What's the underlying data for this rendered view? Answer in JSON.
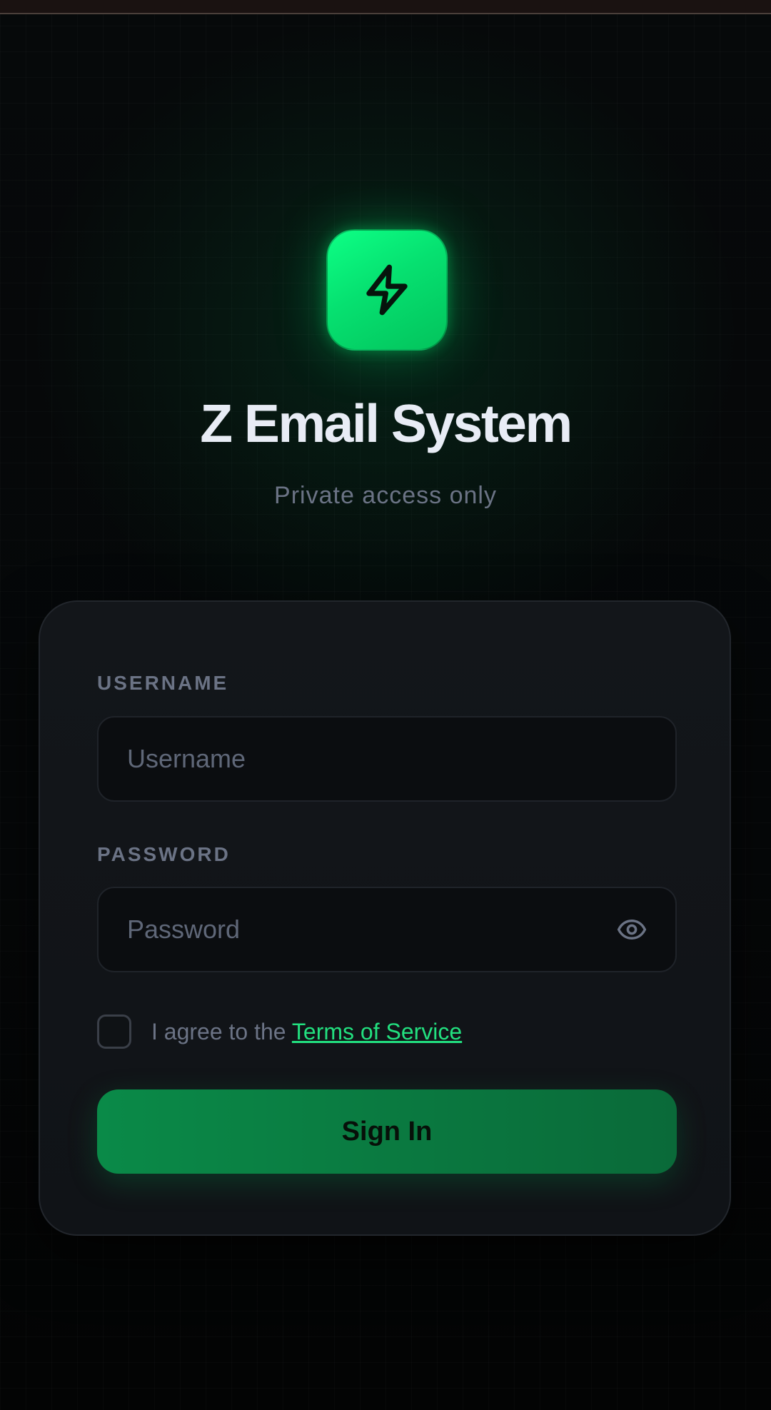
{
  "app": {
    "title": "Z Email System",
    "subtitle": "Private access only",
    "logo_icon": "lightning-bolt-icon"
  },
  "login_form": {
    "username": {
      "label": "USERNAME",
      "placeholder": "Username",
      "value": ""
    },
    "password": {
      "label": "PASSWORD",
      "placeholder": "Password",
      "value": "",
      "toggle_icon": "eye-icon"
    },
    "terms": {
      "checked": false,
      "prefix": "I agree to the ",
      "link_label": "Terms of Service"
    },
    "submit_label": "Sign In"
  },
  "colors": {
    "accent": "#06e070",
    "link": "#22e07f",
    "button": "#0a7a40",
    "background": "#050708",
    "card": "#121519"
  }
}
